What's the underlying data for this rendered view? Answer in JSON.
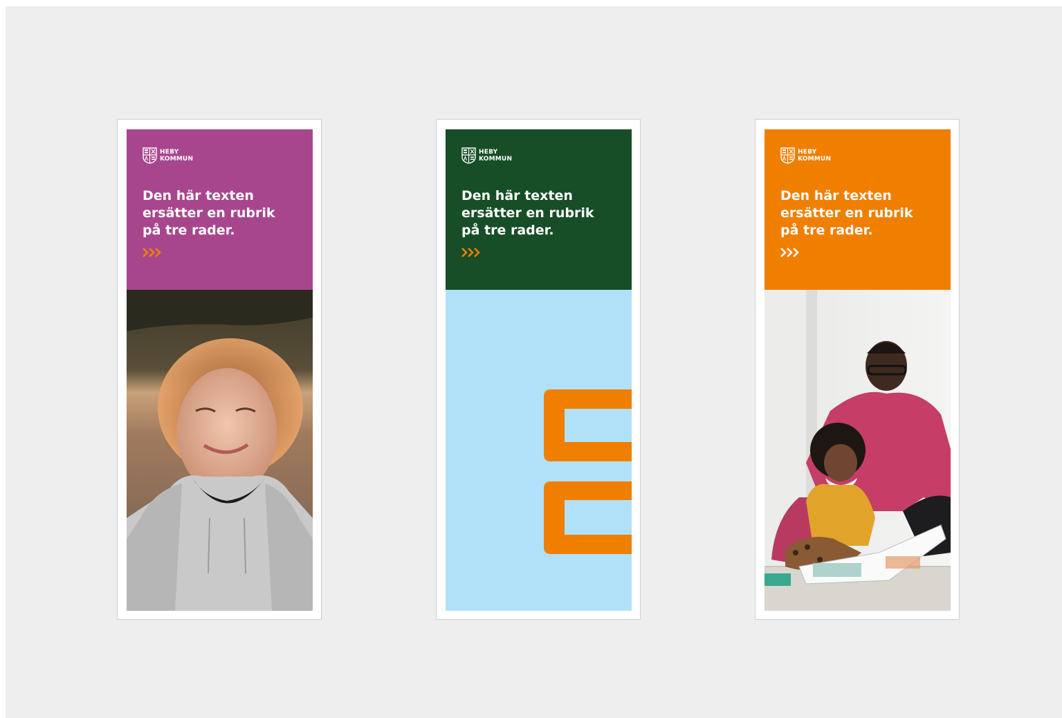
{
  "banners": [
    {
      "panel_color": "#A8468D",
      "logo_line1": "HEBY",
      "logo_line2": "KOMMUN",
      "headline": [
        "Den här texten",
        "ersätter en rubrik",
        "på tre rader."
      ],
      "chevron_color": "#F07F00",
      "media_type": "photo",
      "media_icon": "portrait-photo-icon"
    },
    {
      "panel_color": "#174E27",
      "logo_line1": "HEBY",
      "logo_line2": "KOMMUN",
      "headline": [
        "Den här texten",
        "ersätter en rubrik",
        "på tre rader."
      ],
      "chevron_color": "#F07F00",
      "media_type": "graphic",
      "media_background": "#B1E1F8",
      "graphic_color": "#F07F00",
      "media_icon": "brand-pattern-icon"
    },
    {
      "panel_color": "#F07F00",
      "logo_line1": "HEBY",
      "logo_line2": "KOMMUN",
      "headline": [
        "Den här texten",
        "ersätter en rubrik",
        "på tre rader."
      ],
      "chevron_color": "#FFFFFF",
      "media_type": "photo",
      "media_icon": "reading-photo-icon"
    }
  ]
}
